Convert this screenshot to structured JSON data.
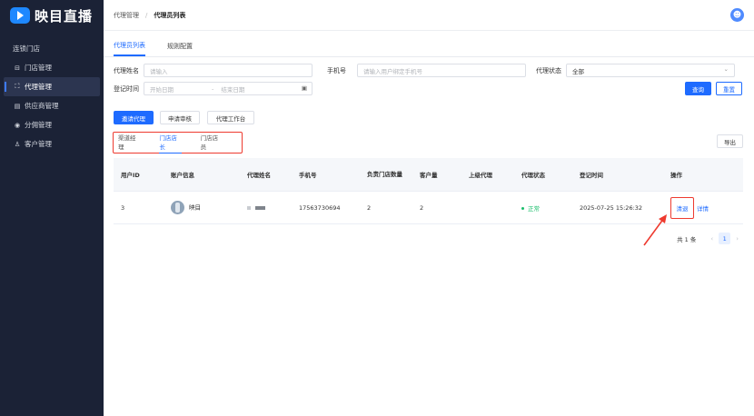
{
  "brand": {
    "name": "映目直播",
    "color": "#1e88ff"
  },
  "sidebar": {
    "store_group": "连锁门店",
    "items": [
      {
        "icon": "store-icon",
        "glyph": "⊟",
        "label": "门店管理",
        "active": false
      },
      {
        "icon": "agent-icon",
        "glyph": "⛶",
        "label": "代理管理",
        "active": true
      },
      {
        "icon": "supplier-icon",
        "glyph": "▤",
        "label": "供应商管理",
        "active": false
      },
      {
        "icon": "commission-icon",
        "glyph": "◉",
        "label": "分佣管理",
        "active": false
      },
      {
        "icon": "customer-icon",
        "glyph": "♙",
        "label": "客户管理",
        "active": false
      }
    ]
  },
  "header": {
    "breadcrumb": [
      "代理管理",
      "代理员列表"
    ],
    "separator": "/",
    "avatar_glyph": "☻"
  },
  "tabs": [
    "代理员列表",
    "规则配置"
  ],
  "filters": {
    "name_label": "代理姓名",
    "name_placeholder": "请输入",
    "phone_label": "手机号",
    "phone_placeholder": "请输入用户绑定手机号",
    "status_label": "代理状态",
    "status_value": "全部",
    "date_label": "登记时间",
    "start_placeholder": "开始日期",
    "date_separator": "-",
    "end_placeholder": "结束日期",
    "calendar_glyph": "▣",
    "chevron_glyph": "⌄"
  },
  "actions": {
    "query": "查询",
    "reset": "重置",
    "invite": "邀请代理",
    "apply_review": "申请审核",
    "workbench": "代理工作台",
    "export": "导出"
  },
  "subtabs": [
    "渠道经理",
    "门店店长",
    "门店店员"
  ],
  "table": {
    "columns": [
      "用户ID",
      "账户信息",
      "代理姓名",
      "手机号",
      "负责门店数量",
      "客户量",
      "上级代理",
      "代理状态",
      "登记时间",
      "操作"
    ],
    "rows": [
      {
        "user_id": "3",
        "account_name": "映目",
        "phone": "17563730694",
        "store_count": "2",
        "customer_count": "2",
        "parent_agent": "",
        "status": "正常",
        "registered_at": "2025-07-25 15:26:32",
        "op_clear": "清退",
        "op_detail": "详情"
      }
    ]
  },
  "pagination": {
    "total": "共 1 条",
    "current_page": "1",
    "prev": "‹",
    "next": "›"
  },
  "colors": {
    "primary": "#1e6bff",
    "annotation": "#ee3a2f",
    "status_ok": "#19be6b",
    "sidebar_bg": "#1b2236"
  }
}
